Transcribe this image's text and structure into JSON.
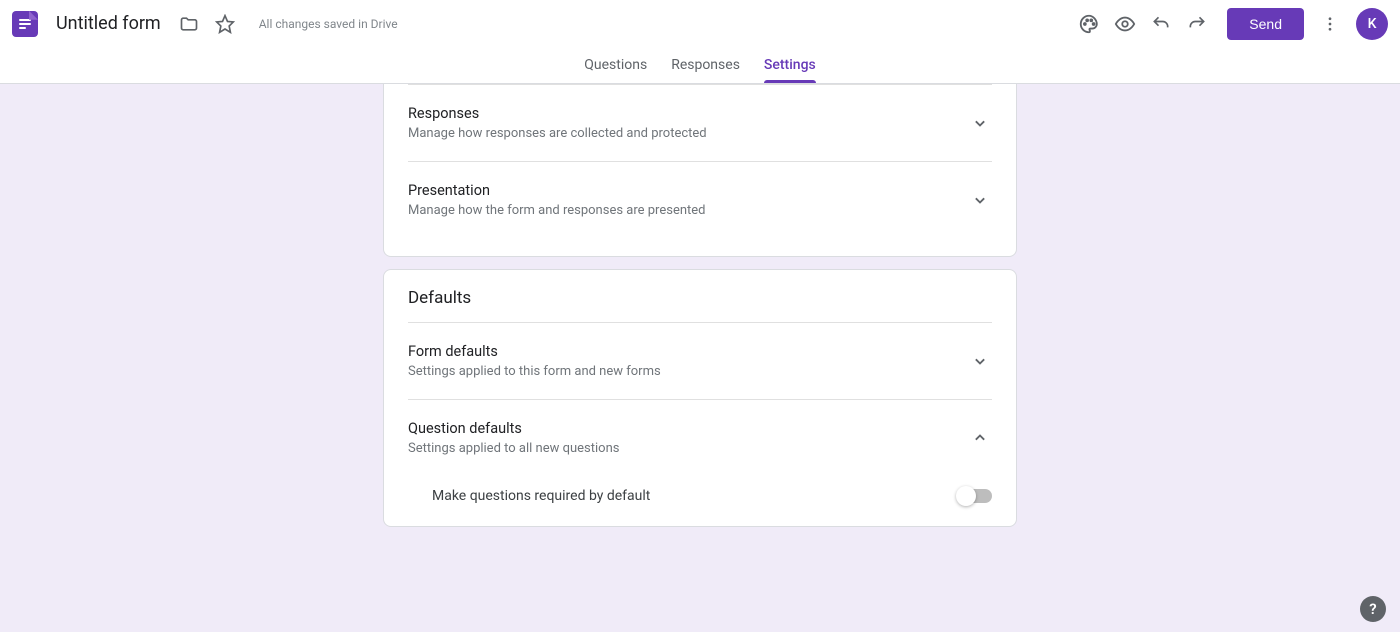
{
  "header": {
    "form_title": "Untitled form",
    "save_status": "All changes saved in Drive",
    "send_label": "Send",
    "avatar_initial": "K"
  },
  "tabs": {
    "questions": "Questions",
    "responses": "Responses",
    "settings": "Settings",
    "active": "settings"
  },
  "settings_card": {
    "responses": {
      "title": "Responses",
      "sub": "Manage how responses are collected and protected"
    },
    "presentation": {
      "title": "Presentation",
      "sub": "Manage how the form and responses are presented"
    }
  },
  "defaults_card": {
    "heading": "Defaults",
    "form_defaults": {
      "title": "Form defaults",
      "sub": "Settings applied to this form and new forms"
    },
    "question_defaults": {
      "title": "Question defaults",
      "sub": "Settings applied to all new questions",
      "option_required": "Make questions required by default",
      "option_required_on": false
    }
  }
}
